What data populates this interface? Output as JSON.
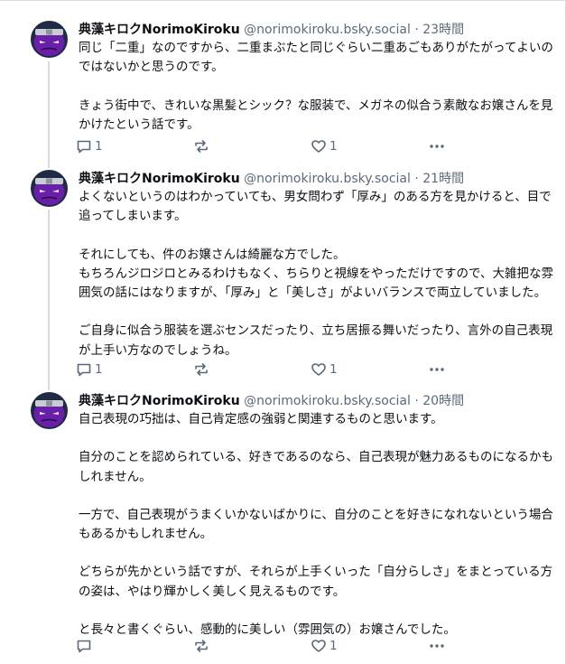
{
  "posts": [
    {
      "author": "典藻キロクNorimoKiroku",
      "handle": "@norimokiroku.bsky.social",
      "separator": "·",
      "time": "23時間",
      "paragraphs": [
        "同じ「二重」なのですから、二重まぶたと同じぐらい二重あごもありがたがってよいのではないかと思うのです。",
        "きょう街中で、きれいな黒髪とシック？な服装で、メガネの似合う素敵なお嬢さんを見かけたという話です。"
      ],
      "reply_count": "1",
      "like_count": "1"
    },
    {
      "author": "典藻キロクNorimoKiroku",
      "handle": "@norimokiroku.bsky.social",
      "separator": "·",
      "time": "21時間",
      "paragraphs": [
        "よくないというのはわかっていても、男女問わず「厚み」のある方を見かけると、目で追ってしまいます。",
        "それにしても、件のお嬢さんは綺麗な方でした。\nもちろんジロジロとみるわけもなく、ちらりと視線をやっただけですので、大雑把な雰囲気の話にはなりますが、「厚み」と「美しさ」がよいバランスで両立していました。",
        "ご自身に似合う服装を選ぶセンスだったり、立ち居振る舞いだったり、言外の自己表現が上手い方なのでしょうね。"
      ],
      "reply_count": "1",
      "like_count": "1"
    },
    {
      "author": "典藻キロクNorimoKiroku",
      "handle": "@norimokiroku.bsky.social",
      "separator": "·",
      "time": "20時間",
      "paragraphs": [
        "自己表現の巧拙は、自己肯定感の強弱と関連するものと思います。",
        "自分のことを認められている、好きであるのなら、自己表現が魅力あるものになるかもしれません。",
        "一方で、自己表現がうまくいかないばかりに、自分のことを好きになれないという場合もあるかもしれません。",
        "どちらが先かという話ですが、それらが上手くいった「自分らしさ」をまとっている方の姿は、やはり輝かしく美しく見えるものです。",
        "と長々と書くぐらい、感動的に美しい（雰囲気の）お嬢さんでした。"
      ],
      "reply_count": "",
      "like_count": "1"
    }
  ],
  "icons": {
    "reply": "reply-icon",
    "repost": "repost-icon",
    "like": "heart-icon",
    "more": "more-icon"
  },
  "colors": {
    "avatar_bg": "#6a1fa8",
    "avatar_face": "#8a2be2",
    "muted": "#5b6a7a",
    "thread_line": "#d4dbe2"
  }
}
